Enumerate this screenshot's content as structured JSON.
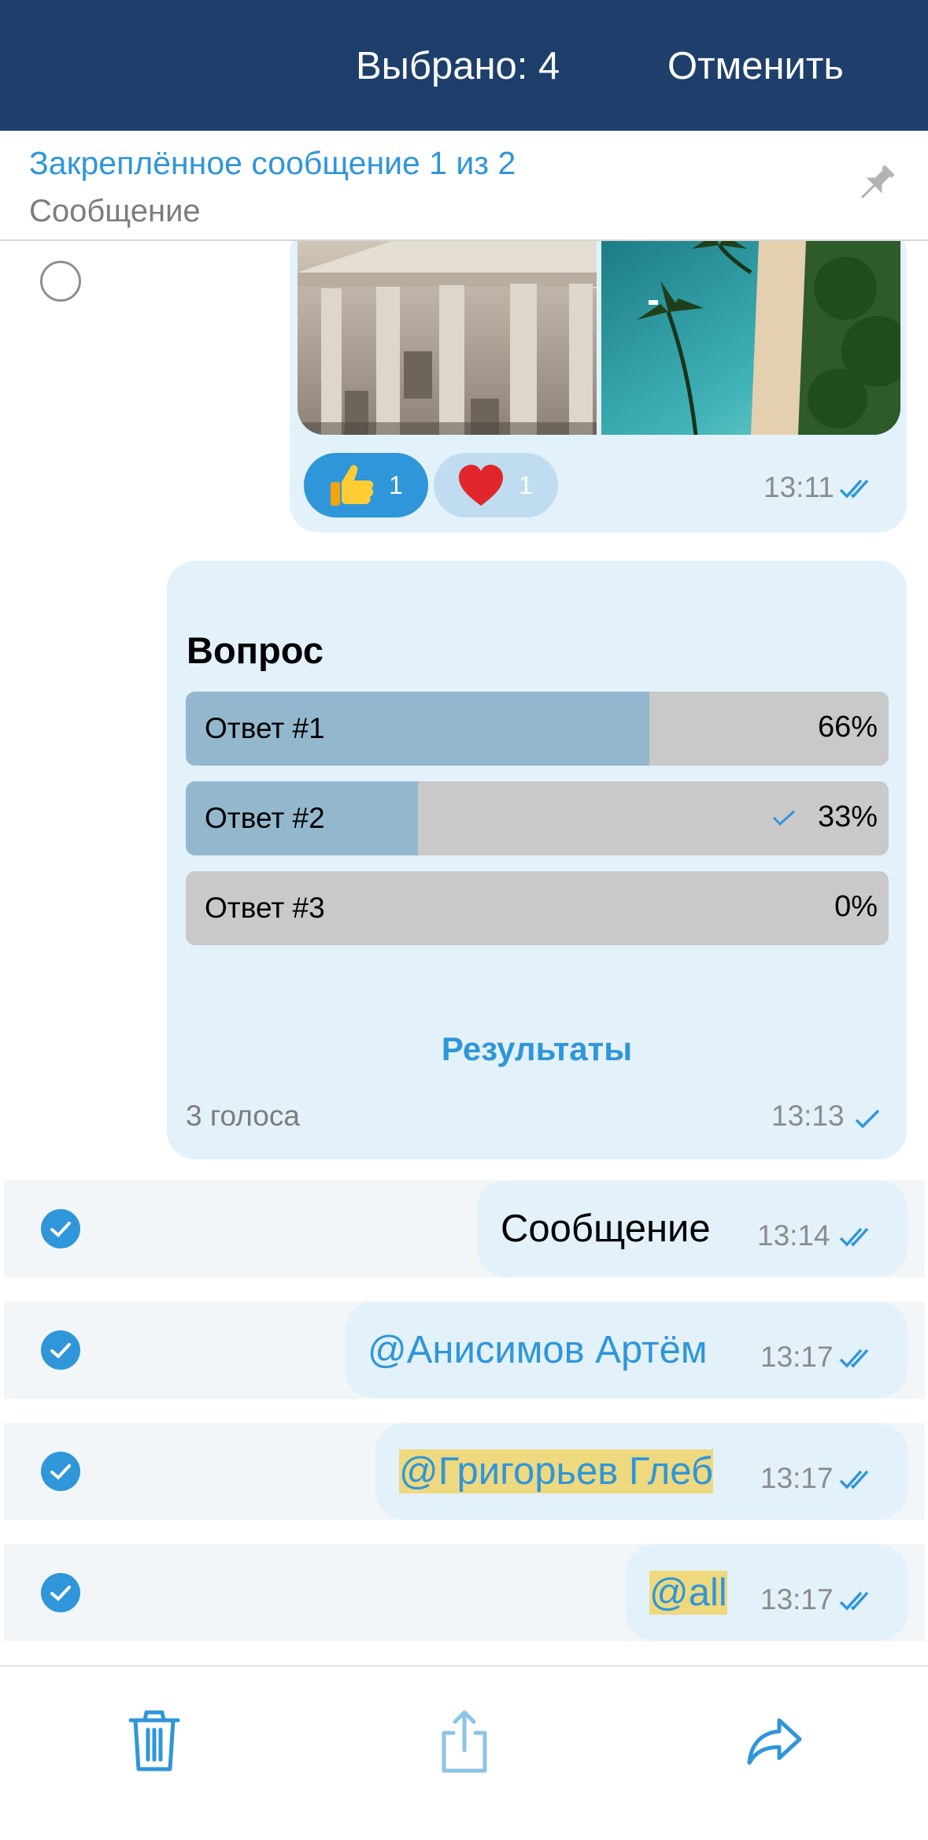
{
  "header": {
    "selected_label": "Выбрано: 4",
    "cancel_label": "Отменить"
  },
  "pinned": {
    "title": "Закреплённое сообщение 1 из 2",
    "subtitle": "Сообщение"
  },
  "photo_message": {
    "reactions": [
      {
        "emoji": "thumbs-up",
        "count": "1"
      },
      {
        "emoji": "heart",
        "count": "1"
      }
    ],
    "time": "13:11"
  },
  "poll": {
    "question": "Вопрос",
    "options": [
      {
        "label": "Ответ #1",
        "percent": "66%",
        "fill": 0.66,
        "voted": false
      },
      {
        "label": "Ответ #2",
        "percent": "33%",
        "fill": 0.33,
        "voted": true
      },
      {
        "label": "Ответ #3",
        "percent": "0%",
        "fill": 0.0,
        "voted": false
      }
    ],
    "results_label": "Результаты",
    "votes": "3 голоса",
    "time": "13:13"
  },
  "messages": [
    {
      "text": "Сообщение",
      "time": "13:14",
      "selected": true
    },
    {
      "text": "@Анисимов Артём",
      "time": "13:17",
      "selected": true
    },
    {
      "text": "@Григорьев Глеб",
      "time": "13:17",
      "selected": true
    },
    {
      "text": "@all",
      "time": "13:17",
      "selected": true
    }
  ],
  "colors": {
    "header_bg": "#1e3f6b",
    "accent": "#2f96da",
    "bubble": "#e3f1fb",
    "highlight": "#eed97f"
  },
  "toolbar": {
    "icons": [
      "trash-icon",
      "share-icon",
      "forward-icon"
    ]
  }
}
